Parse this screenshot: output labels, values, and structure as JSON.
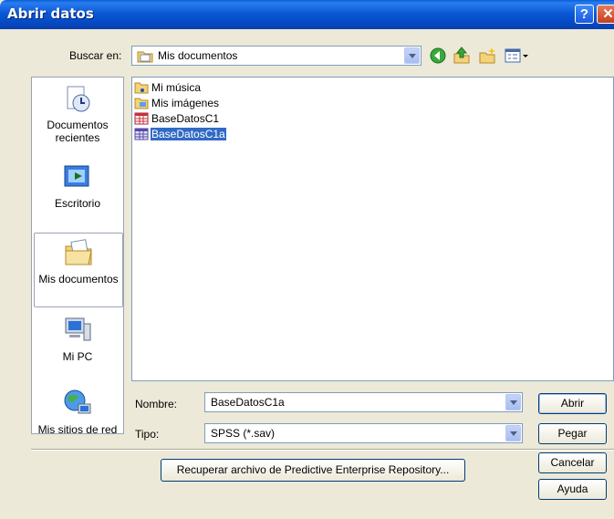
{
  "window": {
    "title": "Abrir datos"
  },
  "titlebar": {
    "help_icon": "help-icon",
    "close_icon": "close-icon",
    "help_glyph": "?",
    "close_glyph": "✕"
  },
  "lookin": {
    "label": "Buscar en:",
    "value": "Mis documentos"
  },
  "toolbar": {
    "icons": [
      "back-icon",
      "up-folder-icon",
      "new-folder-icon",
      "view-menu-icon"
    ]
  },
  "places": [
    {
      "label": "Documentos recientes",
      "icon": "recent-documents-icon"
    },
    {
      "label": "Escritorio",
      "icon": "desktop-icon"
    },
    {
      "label": "Mis documentos",
      "icon": "my-documents-icon",
      "selected": true
    },
    {
      "label": "Mi PC",
      "icon": "my-computer-icon"
    },
    {
      "label": "Mis sitios de red",
      "icon": "network-places-icon"
    }
  ],
  "files": [
    {
      "name": "Mi música",
      "icon": "music-folder-icon"
    },
    {
      "name": "Mis imágenes",
      "icon": "pictures-folder-icon"
    },
    {
      "name": "BaseDatosC1",
      "icon": "spss-data-file-icon"
    },
    {
      "name": "BaseDatosC1a",
      "icon": "spss-data-file-icon",
      "selected": true
    }
  ],
  "filename": {
    "label": "Nombre:",
    "value": "BaseDatosC1a"
  },
  "filetype": {
    "label": "Tipo:",
    "value": "SPSS (*.sav)"
  },
  "buttons": {
    "open": "Abrir",
    "paste": "Pegar",
    "cancel": "Cancelar",
    "help": "Ayuda"
  },
  "repository_button": "Recuperar archivo de Predictive Enterprise Repository...",
  "colors": {
    "titlebar": "#0a58d4",
    "selection": "#316ac5",
    "dialog_bg": "#ece9d8"
  }
}
